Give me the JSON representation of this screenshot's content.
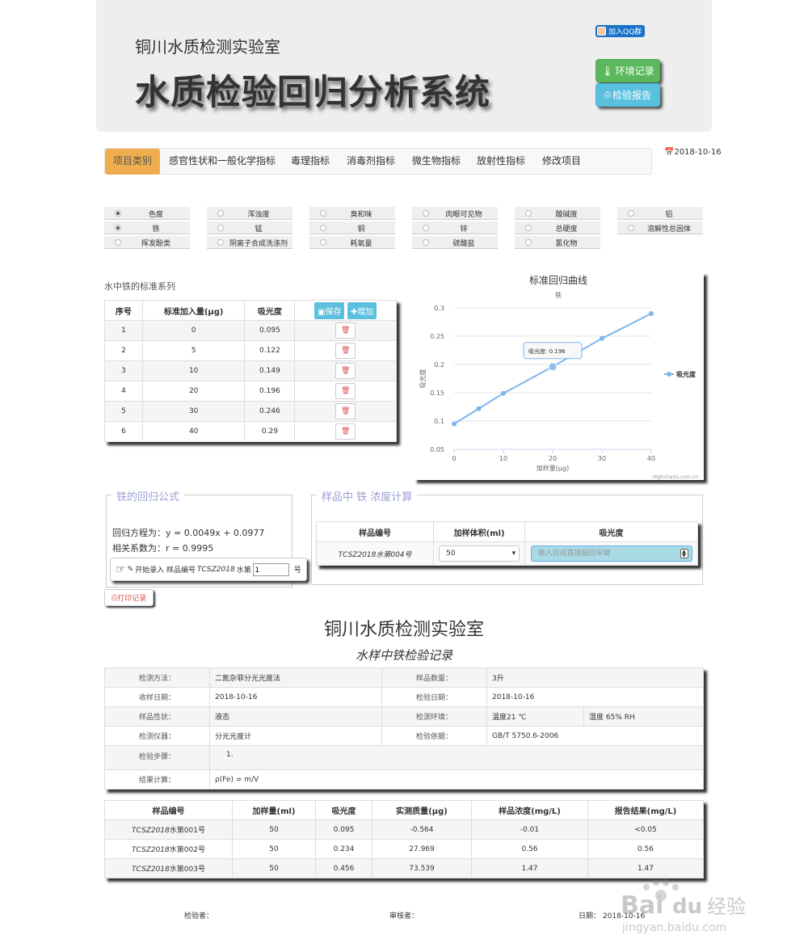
{
  "header": {
    "lab_name": "铜川水质检测实验室",
    "system_title": "水质检验回归分析系统",
    "qq_button": "加入QQ群",
    "env_button": "环境记录",
    "report_button": "检验报告"
  },
  "nav": {
    "items": [
      "项目类别",
      "感官性状和一般化学指标",
      "毒理指标",
      "消毒剂指标",
      "微生物指标",
      "放射性指标",
      "修改项目"
    ],
    "date": "2018-10-16"
  },
  "radios": [
    {
      "label": "色度",
      "checked": true
    },
    {
      "label": "浑浊度",
      "checked": false
    },
    {
      "label": "臭和味",
      "checked": false
    },
    {
      "label": "肉眼可见物",
      "checked": false
    },
    {
      "label": "酸碱度",
      "checked": false
    },
    {
      "label": "铝",
      "checked": false
    },
    {
      "label": "铁",
      "checked": true
    },
    {
      "label": "锰",
      "checked": false
    },
    {
      "label": "铜",
      "checked": false
    },
    {
      "label": "锌",
      "checked": false
    },
    {
      "label": "总硬度",
      "checked": false
    },
    {
      "label": "溶解性总固体",
      "checked": false
    },
    {
      "label": "挥发酚类",
      "checked": false
    },
    {
      "label": "阴离子合成洗涤剂",
      "checked": false
    },
    {
      "label": "耗氧量",
      "checked": false
    },
    {
      "label": "硫酸盐",
      "checked": false
    },
    {
      "label": "氯化物",
      "checked": false
    }
  ],
  "standard": {
    "caption": "水中铁的标准系列",
    "headers": [
      "序号",
      "标准加入量(μg)",
      "吸光度"
    ],
    "save_label": "保存",
    "add_label": "增加",
    "rows": [
      {
        "no": "1",
        "amount": "0",
        "abs": "0.095"
      },
      {
        "no": "2",
        "amount": "5",
        "abs": "0.122"
      },
      {
        "no": "3",
        "amount": "10",
        "abs": "0.149"
      },
      {
        "no": "4",
        "amount": "20",
        "abs": "0.196"
      },
      {
        "no": "5",
        "amount": "30",
        "abs": "0.246"
      },
      {
        "no": "6",
        "amount": "40",
        "abs": "0.29"
      }
    ]
  },
  "chart_data": {
    "type": "line",
    "title": "标准回归曲线",
    "subtitle": "铁",
    "xlabel": "加样量(μg)",
    "ylabel": "吸光度",
    "credit": "Highcharts.com.cn",
    "tooltip_text": "吸光度: 0.196",
    "x": [
      0,
      5,
      10,
      20,
      30,
      40
    ],
    "series": [
      {
        "name": "吸光度",
        "values": [
          0.095,
          0.122,
          0.149,
          0.196,
          0.246,
          0.29
        ]
      }
    ],
    "xlim": [
      0,
      40
    ],
    "ylim": [
      0.05,
      0.3
    ],
    "x_ticks": [
      "0",
      "10",
      "20",
      "30",
      "40"
    ],
    "y_ticks": [
      "0.05",
      "0.1",
      "0.15",
      "0.2",
      "0.25",
      "0.3"
    ],
    "grid": true,
    "legend_position": "right",
    "line_color": "#7cb5ec"
  },
  "formula": {
    "legend": "铁的回归公式",
    "equation": "回归方程为：y = 0.0049x + 0.0977",
    "correlation": "相关系数为：r = 0.9995",
    "entry_prefix": "开始录入 样品编号",
    "entry_code": "TCSZ2018",
    "entry_mid": "水第",
    "entry_value": "1",
    "entry_suffix": "号"
  },
  "print_button": "打印记录",
  "sample_calc": {
    "legend": "样品中 铁 浓度计算",
    "headers": [
      "样品编号",
      "加样体积(ml)",
      "吸光度"
    ],
    "sample_id": "TCSZ2018水第004号",
    "volume": "50",
    "abs_placeholder": "输入完成直接按回车键"
  },
  "report": {
    "title": "铜川水质检测实验室",
    "subtitle": "水样中铁检验记录",
    "info": {
      "method_label": "检测方法：",
      "method": "二氮杂菲分光光度法",
      "qty_label": "样品数量：",
      "qty": "3升",
      "recv_label": "收样日期：",
      "recv": "2018-10-16",
      "test_date_label": "检验日期：",
      "test_date": "2018-10-16",
      "state_label": "样品性状：",
      "state": "液态",
      "env_label": "检测环境：",
      "temp": "温度21 ℃",
      "humidity": "湿度 65% RH",
      "instrument_label": "检测仪器：",
      "instrument": "分光光度计",
      "basis_label": "检验依据：",
      "basis": "GB/T 5750.6-2006",
      "steps_label": "检验步骤：",
      "steps": "1.",
      "calc_label": "结果计算：",
      "calc": "ρ(Fe) = m/V"
    },
    "result_headers": [
      "样品编号",
      "加样量(ml)",
      "吸光度",
      "实测质量(μg)",
      "样品浓度(mg/L)",
      "报告结果(mg/L)"
    ],
    "results": [
      {
        "id_code": "TCSZ2018",
        "id_rest": "水第001号",
        "vol": "50",
        "abs": "0.095",
        "mass": "-0.564",
        "conc": "-0.01",
        "report": "<0.05"
      },
      {
        "id_code": "TCSZ2018",
        "id_rest": "水第002号",
        "vol": "50",
        "abs": "0.234",
        "mass": "27.969",
        "conc": "0.56",
        "report": "0.56"
      },
      {
        "id_code": "TCSZ2018",
        "id_rest": "水第003号",
        "vol": "50",
        "abs": "0.456",
        "mass": "73.539",
        "conc": "1.47",
        "report": "1.47"
      }
    ],
    "inspector_label": "检验者：",
    "reviewer_label": "审核者：",
    "date_label": "日期：",
    "date": "2018-10-16"
  },
  "watermark": {
    "text1": "Bai",
    "text2": "du",
    "text3": "经验",
    "url": "jingyan.baidu.com"
  }
}
